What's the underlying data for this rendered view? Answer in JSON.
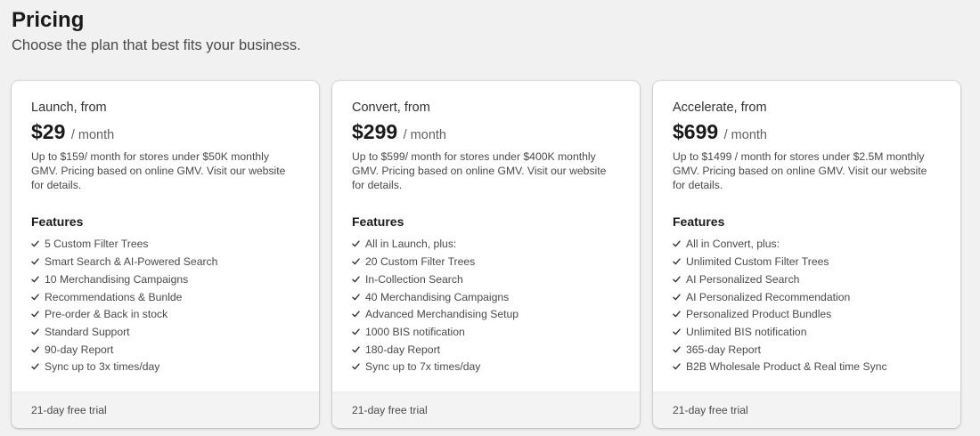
{
  "header": {
    "title": "Pricing",
    "subtitle": "Choose the plan that best fits your business."
  },
  "plans": [
    {
      "name": "Launch, from",
      "price": "$29",
      "period": "/ month",
      "description": "Up to $159/ month for stores under $50K monthly GMV. Pricing based on online GMV. Visit our website for details.",
      "features_heading": "Features",
      "features": [
        "5 Custom Filter Trees",
        "Smart Search & AI-Powered Search",
        "10 Merchandising Campaigns",
        "Recommendations & Bunlde",
        "Pre-order & Back in stock",
        "Standard Support",
        "90-day Report",
        "Sync up to 3x times/day"
      ],
      "footer": "21-day free trial"
    },
    {
      "name": "Convert, from",
      "price": "$299",
      "period": "/ month",
      "description": "Up to $599/ month for stores under $400K monthly GMV. Pricing based on online GMV. Visit our website for details.",
      "features_heading": "Features",
      "features": [
        "All in Launch, plus:",
        "20 Custom Filter Trees",
        "In-Collection Search",
        "40 Merchandising Campaigns",
        "Advanced Merchandising Setup",
        "1000 BIS notification",
        "180-day Report",
        "Sync up to 7x times/day"
      ],
      "footer": "21-day free trial"
    },
    {
      "name": "Accelerate, from",
      "price": "$699",
      "period": "/ month",
      "description": "Up to $1499 / month for stores under $2.5M monthly GMV. Pricing based on online GMV. Visit our website for details.",
      "features_heading": "Features",
      "features": [
        "All in Convert, plus:",
        "Unlimited Custom Filter Trees",
        "AI Personalized Search",
        "AI Personalized Recommendation",
        "Personalized Product Bundles",
        "Unlimited BIS notification",
        "365-day Report",
        "B2B Wholesale Product & Real time Sync"
      ],
      "footer": "21-day free trial"
    }
  ],
  "icons": {
    "feature_bullet": "check-icon"
  },
  "colors": {
    "background": "#f1f1f1",
    "card": "#ffffff",
    "footer": "#f3f3f3",
    "text": "#303030"
  }
}
